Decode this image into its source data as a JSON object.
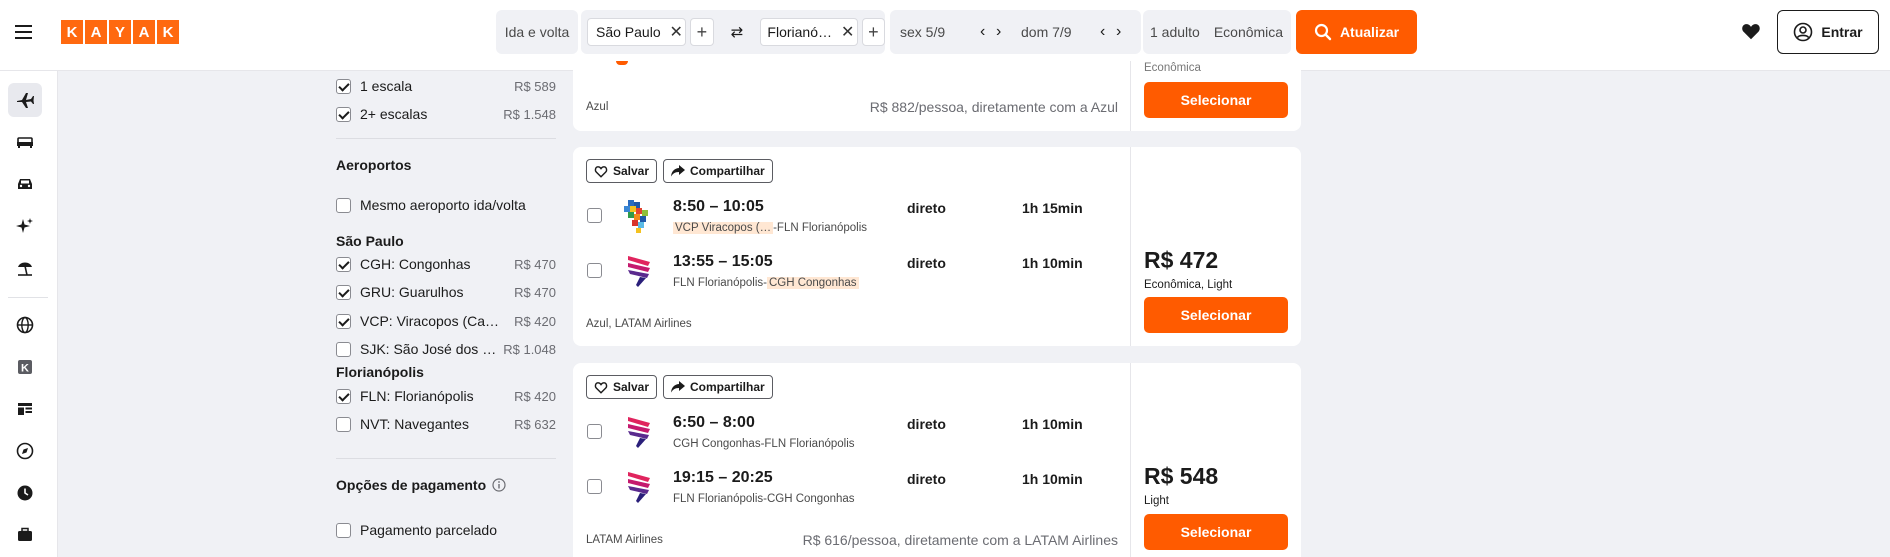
{
  "brand": {
    "letters": [
      "K",
      "A",
      "Y",
      "A",
      "K"
    ],
    "accent": "#ff690f",
    "button": "#ff5b00"
  },
  "search": {
    "trip_type": "Ida e volta",
    "origin": "São Paulo",
    "destination": "Florianó…",
    "depart": "sex 5/9",
    "return": "dom 7/9",
    "passengers": "1 adulto",
    "cabin": "Econômica",
    "update_label": "Atualizar"
  },
  "header": {
    "login_label": "Entrar"
  },
  "filters": {
    "stops": [
      {
        "label": "1 escala",
        "price": "R$ 589",
        "checked": true
      },
      {
        "label": "2+ escalas",
        "price": "R$ 1.548",
        "checked": true
      }
    ],
    "airports_heading": "Aeroportos",
    "same_airport_label": "Mesmo aeroporto ida/volta",
    "origin_city": "São Paulo",
    "origin_airports": [
      {
        "label": "CGH: Congonhas",
        "price": "R$ 470",
        "checked": true
      },
      {
        "label": "GRU: Guarulhos",
        "price": "R$ 470",
        "checked": true
      },
      {
        "label": "VCP: Viracopos (Cam…",
        "price": "R$ 420",
        "checked": true
      },
      {
        "label": "SJK: São José dos C…",
        "price": "R$ 1.048",
        "checked": false
      }
    ],
    "dest_city": "Florianópolis",
    "dest_airports": [
      {
        "label": "FLN: Florianópolis",
        "price": "R$ 420",
        "checked": true
      },
      {
        "label": "NVT: Navegantes",
        "price": "R$ 632",
        "checked": false
      }
    ],
    "payment_heading": "Opções de pagamento",
    "installments_label": "Pagamento parcelado"
  },
  "results": {
    "save_label": "Salvar",
    "share_label": "Compartilhar",
    "select_label": "Selecionar",
    "card0": {
      "airline": "Azul",
      "note": "R$ 882/pessoa, diretamente com a Azul",
      "fare": "Econômica"
    },
    "card1": {
      "outbound": {
        "times": "8:50 – 10:05",
        "from": "VCP Viracopos (…",
        "to": "-FLN Florianópolis",
        "stops": "direto",
        "duration": "1h 15min"
      },
      "inbound": {
        "times": "13:55 – 15:05",
        "from": "FLN Florianópolis-",
        "to": "CGH Congonhas",
        "stops": "direto",
        "duration": "1h 10min"
      },
      "airline": "Azul, LATAM Airlines",
      "price": "R$ 472",
      "fare": "Econômica, Light"
    },
    "card2": {
      "outbound": {
        "times": "6:50 – 8:00",
        "route": "CGH Congonhas-FLN Florianópolis",
        "stops": "direto",
        "duration": "1h 10min"
      },
      "inbound": {
        "times": "19:15 – 20:25",
        "route": "FLN Florianópolis-CGH Congonhas",
        "stops": "direto",
        "duration": "1h 10min"
      },
      "airline": "LATAM Airlines",
      "note": "R$ 616/pessoa, diretamente com a LATAM Airlines",
      "price": "R$ 548",
      "fare": "Light"
    }
  }
}
